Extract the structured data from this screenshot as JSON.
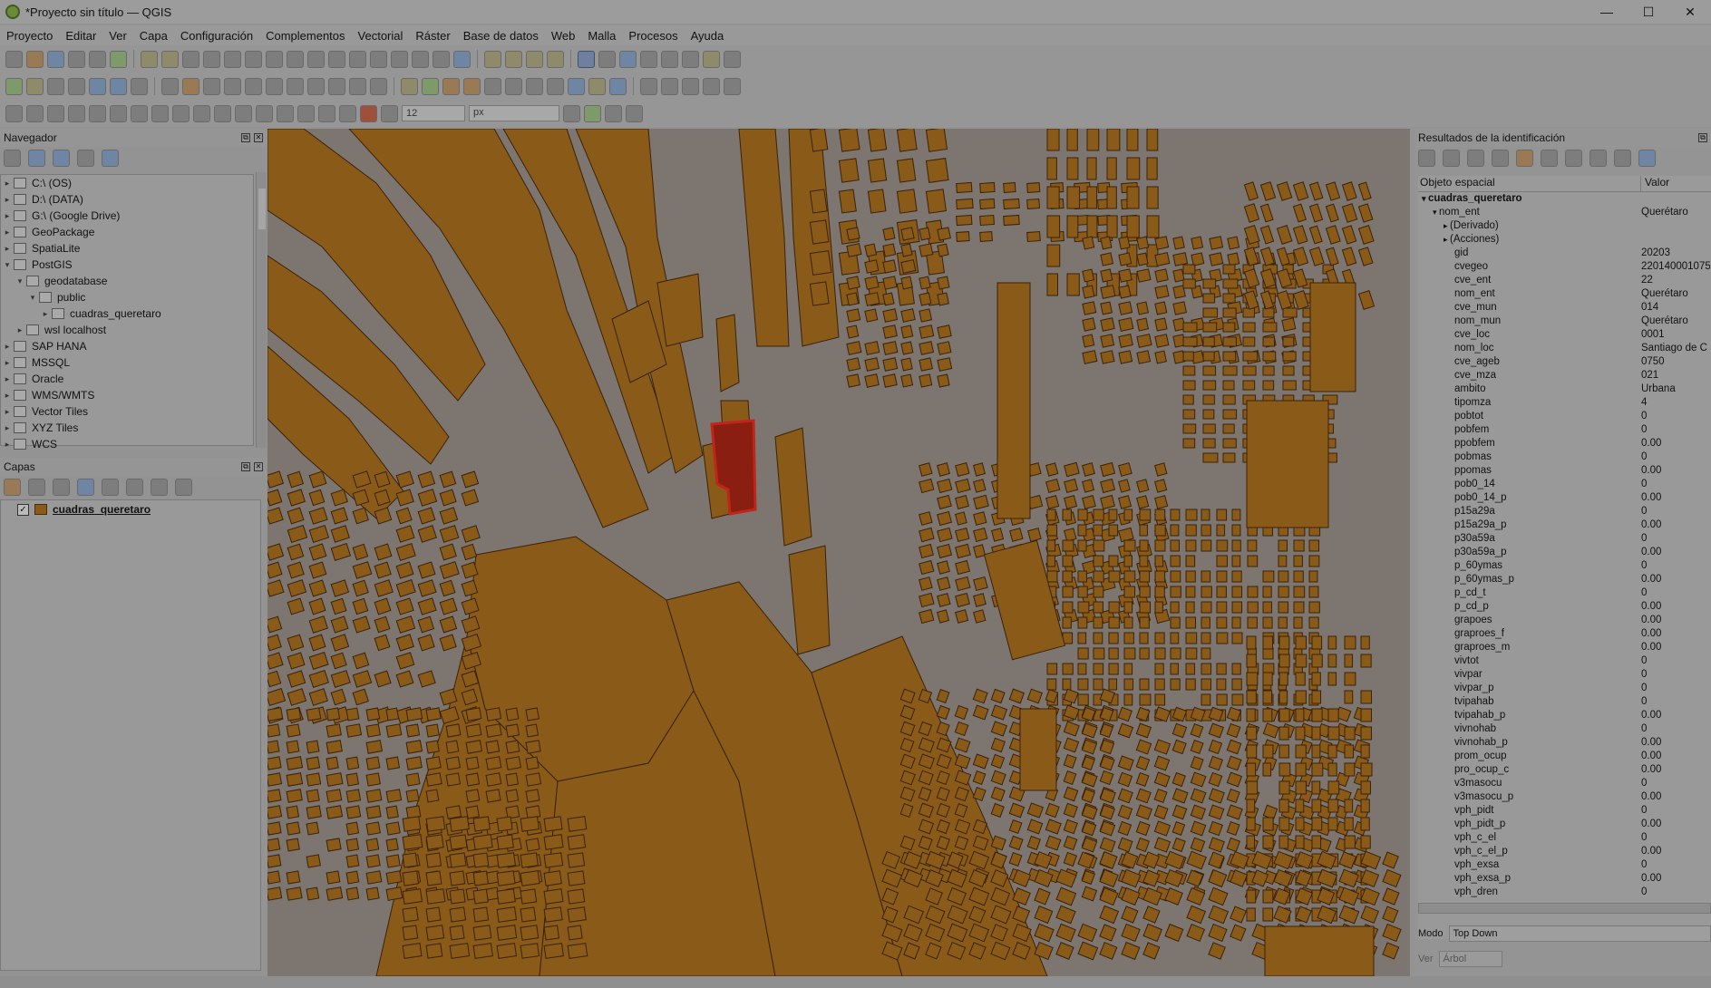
{
  "window": {
    "title": "*Proyecto sin título — QGIS",
    "controls": [
      "—",
      "☐",
      "✕"
    ]
  },
  "menu": [
    "Proyecto",
    "Editar",
    "Ver",
    "Capa",
    "Configuración",
    "Complementos",
    "Vectorial",
    "Ráster",
    "Base de datos",
    "Web",
    "Malla",
    "Procesos",
    "Ayuda"
  ],
  "toolbar": {
    "size_value": "12",
    "unit_value": "px"
  },
  "navigator": {
    "title": "Navegador",
    "items": [
      {
        "label": "C:\\ (OS)",
        "level": 0
      },
      {
        "label": "D:\\ (DATA)",
        "level": 0
      },
      {
        "label": "G:\\ (Google Drive)",
        "level": 0
      },
      {
        "label": "GeoPackage",
        "level": 0
      },
      {
        "label": "SpatiaLite",
        "level": 0
      },
      {
        "label": "PostGIS",
        "level": 0
      },
      {
        "label": "geodatabase",
        "level": 1
      },
      {
        "label": "public",
        "level": 2
      },
      {
        "label": "cuadras_queretaro",
        "level": 3
      },
      {
        "label": "wsl localhost",
        "level": 1
      },
      {
        "label": "SAP HANA",
        "level": 0
      },
      {
        "label": "MSSQL",
        "level": 0
      },
      {
        "label": "Oracle",
        "level": 0
      },
      {
        "label": "WMS/WMTS",
        "level": 0
      },
      {
        "label": "Vector Tiles",
        "level": 0
      },
      {
        "label": "XYZ Tiles",
        "level": 0
      },
      {
        "label": "WCS",
        "level": 0
      }
    ]
  },
  "layers": {
    "title": "Capas",
    "items": [
      {
        "label": "cuadras_queretaro",
        "checked": true,
        "color": "#8a5a18"
      }
    ]
  },
  "identify": {
    "title": "Resultados de la identificación",
    "col_feature": "Objeto espacial",
    "col_value": "Valor",
    "rows": [
      {
        "k": "cuadras_queretaro",
        "v": "",
        "level": 0,
        "bold": true,
        "arrow": "▾"
      },
      {
        "k": "nom_ent",
        "v": "Querétaro",
        "level": 1,
        "arrow": "▾"
      },
      {
        "k": "(Derivado)",
        "v": "",
        "level": 2,
        "arrow": "▸"
      },
      {
        "k": "(Acciones)",
        "v": "",
        "level": 2,
        "arrow": "▸"
      },
      {
        "k": "gid",
        "v": "20203",
        "level": 2
      },
      {
        "k": "cvegeo",
        "v": "220140001075",
        "level": 2
      },
      {
        "k": "cve_ent",
        "v": "22",
        "level": 2
      },
      {
        "k": "nom_ent",
        "v": "Querétaro",
        "level": 2
      },
      {
        "k": "cve_mun",
        "v": "014",
        "level": 2
      },
      {
        "k": "nom_mun",
        "v": "Querétaro",
        "level": 2
      },
      {
        "k": "cve_loc",
        "v": "0001",
        "level": 2
      },
      {
        "k": "nom_loc",
        "v": "Santiago de C",
        "level": 2
      },
      {
        "k": "cve_ageb",
        "v": "0750",
        "level": 2
      },
      {
        "k": "cve_mza",
        "v": "021",
        "level": 2
      },
      {
        "k": "ambito",
        "v": "Urbana",
        "level": 2
      },
      {
        "k": "tipomza",
        "v": "4",
        "level": 2
      },
      {
        "k": "pobtot",
        "v": "0",
        "level": 2
      },
      {
        "k": "pobfem",
        "v": "0",
        "level": 2
      },
      {
        "k": "ppobfem",
        "v": "0.00",
        "level": 2
      },
      {
        "k": "pobmas",
        "v": "0",
        "level": 2
      },
      {
        "k": "ppomas",
        "v": "0.00",
        "level": 2
      },
      {
        "k": "pob0_14",
        "v": "0",
        "level": 2
      },
      {
        "k": "pob0_14_p",
        "v": "0.00",
        "level": 2
      },
      {
        "k": "p15a29a",
        "v": "0",
        "level": 2
      },
      {
        "k": "p15a29a_p",
        "v": "0.00",
        "level": 2
      },
      {
        "k": "p30a59a",
        "v": "0",
        "level": 2
      },
      {
        "k": "p30a59a_p",
        "v": "0.00",
        "level": 2
      },
      {
        "k": "p_60ymas",
        "v": "0",
        "level": 2
      },
      {
        "k": "p_60ymas_p",
        "v": "0.00",
        "level": 2
      },
      {
        "k": "p_cd_t",
        "v": "0",
        "level": 2
      },
      {
        "k": "p_cd_p",
        "v": "0.00",
        "level": 2
      },
      {
        "k": "grapoes",
        "v": "0.00",
        "level": 2
      },
      {
        "k": "graproes_f",
        "v": "0.00",
        "level": 2
      },
      {
        "k": "graproes_m",
        "v": "0.00",
        "level": 2
      },
      {
        "k": "vivtot",
        "v": "0",
        "level": 2
      },
      {
        "k": "vivpar",
        "v": "0",
        "level": 2
      },
      {
        "k": "vivpar_p",
        "v": "0",
        "level": 2
      },
      {
        "k": "tvipahab",
        "v": "0",
        "level": 2
      },
      {
        "k": "tvipahab_p",
        "v": "0.00",
        "level": 2
      },
      {
        "k": "vivnohab",
        "v": "0",
        "level": 2
      },
      {
        "k": "vivnohab_p",
        "v": "0.00",
        "level": 2
      },
      {
        "k": "prom_ocup",
        "v": "0.00",
        "level": 2
      },
      {
        "k": "pro_ocup_c",
        "v": "0.00",
        "level": 2
      },
      {
        "k": "v3masocu",
        "v": "0",
        "level": 2
      },
      {
        "k": "v3masocu_p",
        "v": "0.00",
        "level": 2
      },
      {
        "k": "vph_pidt",
        "v": "0",
        "level": 2
      },
      {
        "k": "vph_pidt_p",
        "v": "0.00",
        "level": 2
      },
      {
        "k": "vph_c_el",
        "v": "0",
        "level": 2
      },
      {
        "k": "vph_c_el_p",
        "v": "0.00",
        "level": 2
      },
      {
        "k": "vph_exsa",
        "v": "0",
        "level": 2
      },
      {
        "k": "vph_exsa_p",
        "v": "0.00",
        "level": 2
      },
      {
        "k": "vph_dren",
        "v": "0",
        "level": 2
      }
    ],
    "mode_label": "Modo",
    "mode_value": "Top Down",
    "view_label": "Ver",
    "view_value": "Árbol"
  },
  "colors": {
    "block_fill": "#8a5a18",
    "block_stroke": "#3a2208",
    "road": "#7d7670",
    "selected": "#8a1e10",
    "selected_stroke": "#c0241a"
  }
}
